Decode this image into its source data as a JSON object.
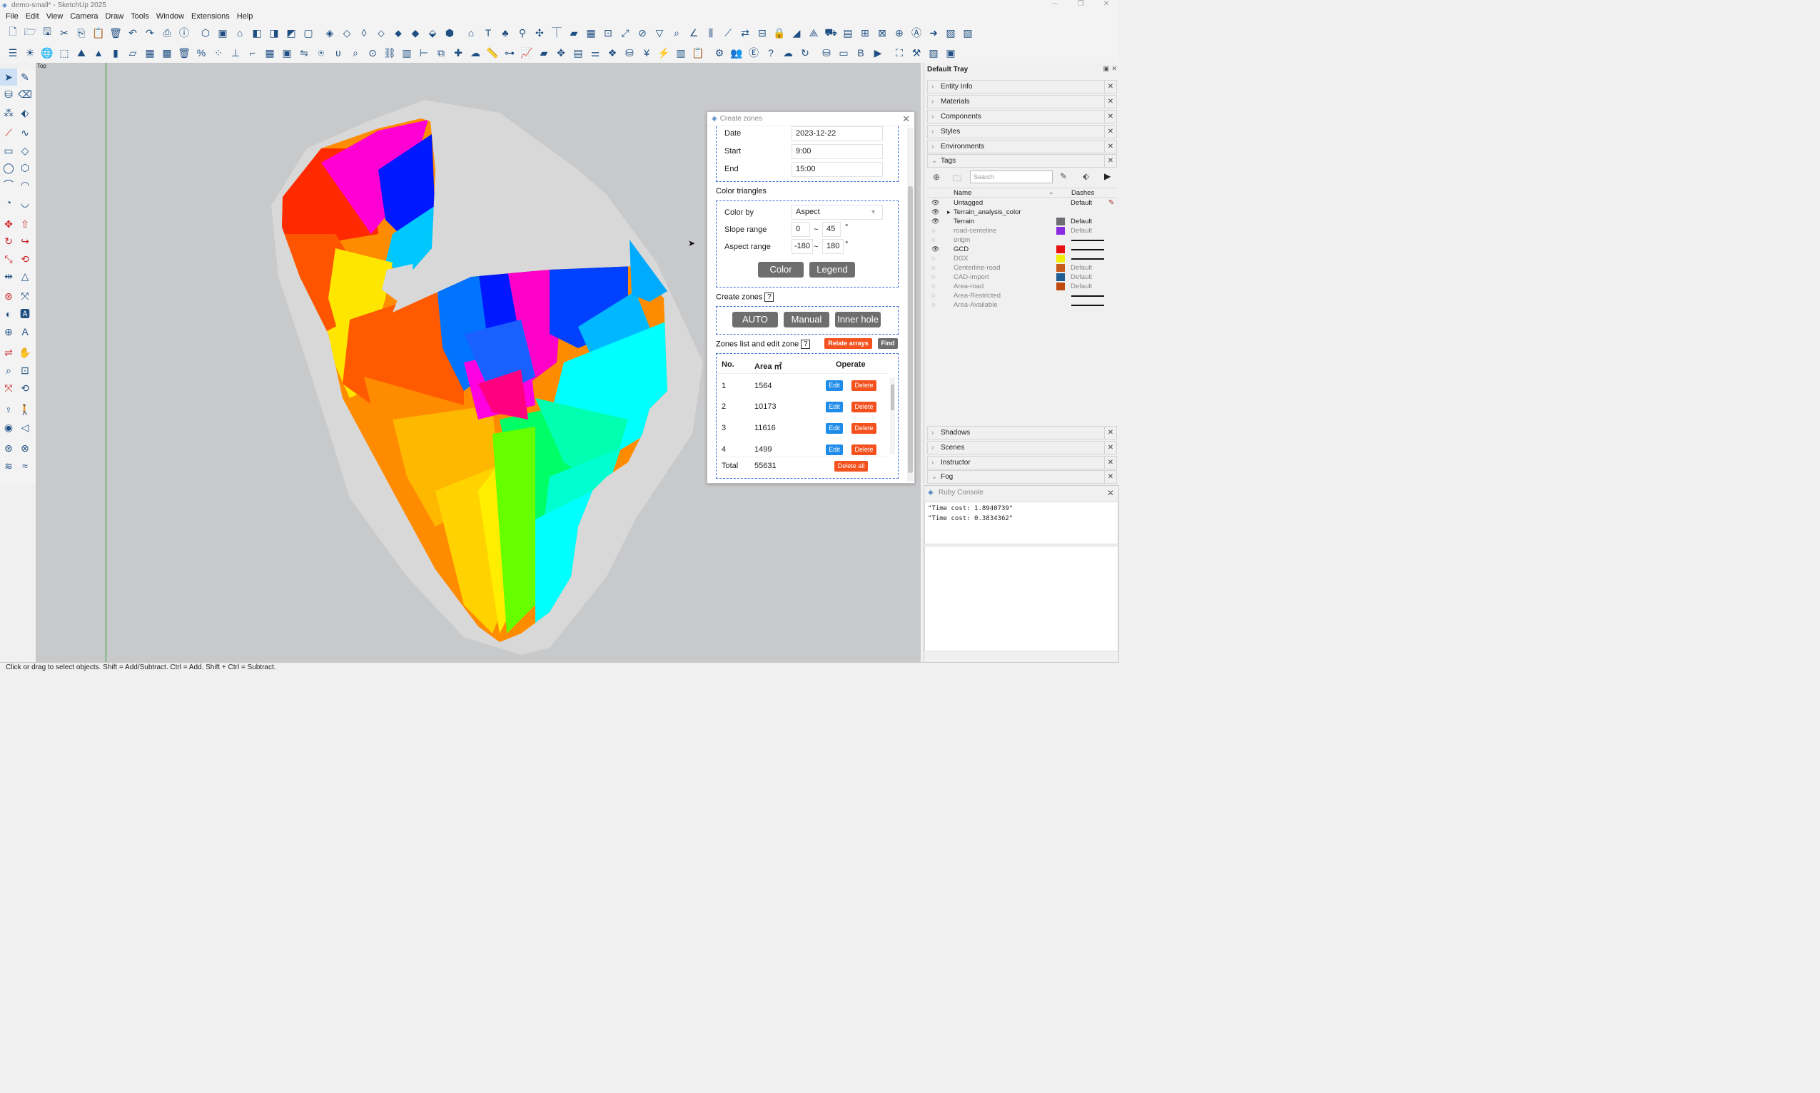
{
  "window": {
    "title": "demo-small* - SketchUp 2025"
  },
  "menu": [
    "File",
    "Edit",
    "View",
    "Camera",
    "Draw",
    "Tools",
    "Window",
    "Extensions",
    "Help"
  ],
  "viewport": {
    "label": "Top"
  },
  "status": {
    "text": "Click or drag to select objects. Shift = Add/Subtract. Ctrl = Add. Shift + Ctrl = Subtract."
  },
  "dialog": {
    "title": "Create zones",
    "date_label": "Date",
    "date_value": "2023-12-22",
    "start_label": "Start",
    "start_value": "9:00",
    "end_label": "End",
    "end_value": "15:00",
    "color_section": "Color triangles",
    "color_by_label": "Color by",
    "color_by_value": "Aspect",
    "slope_label": "Slope range",
    "slope_min": "0",
    "slope_max": "45",
    "aspect_label": "Aspect range",
    "aspect_min": "-180",
    "aspect_max": "180",
    "range_sep": "~",
    "degree": "°",
    "color_btn": "Color",
    "legend_btn": "Legend",
    "zones_section": "Create zones",
    "help": "?",
    "auto_btn": "AUTO",
    "manual_btn": "Manual",
    "inner_hole_btn": "Inner hole",
    "list_section": "Zones list and edit zone",
    "relate_btn": "Relate arrays",
    "find_btn": "Find",
    "col_no": "No.",
    "col_area": "Area ㎡",
    "col_operate": "Operate",
    "edit": "Edit",
    "delete": "Delete",
    "zones": [
      {
        "no": "1",
        "area": "1564"
      },
      {
        "no": "2",
        "area": "10173"
      },
      {
        "no": "3",
        "area": "11616"
      },
      {
        "no": "4",
        "area": "1499"
      }
    ],
    "total_label": "Total",
    "total_value": "55631",
    "delete_all": "Delete all"
  },
  "tray": {
    "title": "Default Tray",
    "panels_top": [
      "Entity Info",
      "Materials",
      "Components",
      "Styles",
      "Environments",
      "Tags"
    ],
    "search_placeholder": "Search",
    "col_name": "Name",
    "col_dashes": "Dashes",
    "tags": [
      {
        "name": "Untagged",
        "visible": true,
        "color": "",
        "dash": "Default",
        "grey": false
      },
      {
        "name": "Terrain_analysis_color",
        "visible": true,
        "color": "",
        "dash": "",
        "grey": false
      },
      {
        "name": "Terrain",
        "visible": true,
        "color": "#6e6e72",
        "dash": "Default",
        "grey": false
      },
      {
        "name": "road-centeline",
        "visible": false,
        "color": "#8a2be2",
        "dash": "Default",
        "grey": true
      },
      {
        "name": "origin",
        "visible": false,
        "color": "",
        "dash": "line",
        "grey": true
      },
      {
        "name": "GCD",
        "visible": true,
        "color": "#e81010",
        "dash": "line",
        "grey": false
      },
      {
        "name": "DGX",
        "visible": false,
        "color": "#f2ee0a",
        "dash": "line",
        "grey": true
      },
      {
        "name": "Centerline-road",
        "visible": false,
        "color": "#c85a1a",
        "dash": "Default",
        "grey": true
      },
      {
        "name": "CAD-import",
        "visible": false,
        "color": "#1f5f96",
        "dash": "Default",
        "grey": true
      },
      {
        "name": "Area-road",
        "visible": false,
        "color": "#c04a10",
        "dash": "Default",
        "grey": true
      },
      {
        "name": "Area-Restricted",
        "visible": false,
        "color": "",
        "dash": "line",
        "grey": true
      },
      {
        "name": "Area-Available",
        "visible": false,
        "color": "",
        "dash": "line",
        "grey": true
      }
    ],
    "panels_bottom": [
      "Shadows",
      "Scenes",
      "Instructor",
      "Fog"
    ]
  },
  "ruby": {
    "title": "Ruby Console",
    "lines": [
      "\"Time cost: 1.8940739\"",
      "\"Time cost: 0.3834362\""
    ]
  }
}
